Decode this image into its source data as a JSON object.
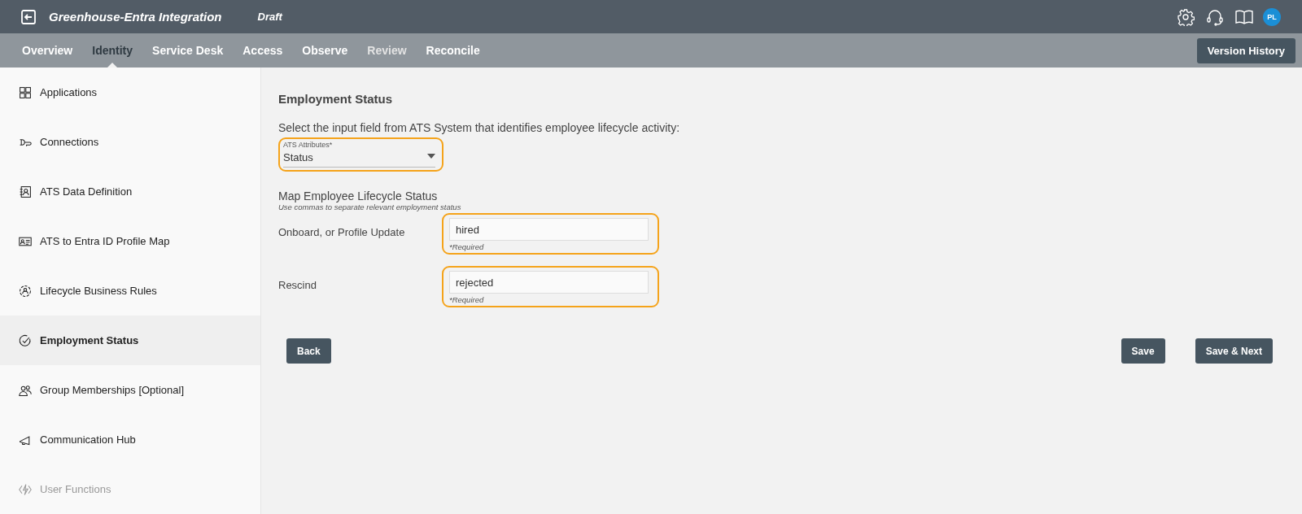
{
  "header": {
    "title": "Greenhouse-Entra Integration",
    "status": "Draft",
    "avatar": "PL"
  },
  "tabs": [
    {
      "label": "Overview",
      "selected": false,
      "disabled": false
    },
    {
      "label": "Identity",
      "selected": true,
      "disabled": false
    },
    {
      "label": "Service Desk",
      "selected": false,
      "disabled": false
    },
    {
      "label": "Access",
      "selected": false,
      "disabled": false
    },
    {
      "label": "Observe",
      "selected": false,
      "disabled": false
    },
    {
      "label": "Review",
      "selected": false,
      "disabled": true
    },
    {
      "label": "Reconcile",
      "selected": false,
      "disabled": false
    }
  ],
  "version_history_button": "Version History",
  "sidebar": {
    "items": [
      {
        "label": "Applications",
        "kind": "grid",
        "selected": false,
        "disabled": false
      },
      {
        "label": "Connections",
        "kind": "plug",
        "selected": false,
        "disabled": false
      },
      {
        "label": "ATS Data Definition",
        "kind": "contact",
        "selected": false,
        "disabled": false
      },
      {
        "label": "ATS to Entra ID Profile Map",
        "kind": "idcard",
        "selected": false,
        "disabled": false
      },
      {
        "label": "Lifecycle Business Rules",
        "kind": "cycle",
        "selected": false,
        "disabled": false
      },
      {
        "label": "Employment Status",
        "kind": "check",
        "selected": true,
        "disabled": false
      },
      {
        "label": "Group Memberships [Optional]",
        "kind": "people",
        "selected": false,
        "disabled": false
      },
      {
        "label": "Communication Hub",
        "kind": "megaphone",
        "selected": false,
        "disabled": false
      },
      {
        "label": "User Functions",
        "kind": "bolt",
        "selected": false,
        "disabled": true
      }
    ]
  },
  "content": {
    "title": "Employment Status",
    "instruction": "Select the input field from ATS System that identifies employee lifecycle activity:",
    "ats_attributes": {
      "label": "ATS Attributes*",
      "value": "Status"
    },
    "map_title": "Map Employee Lifecycle Status",
    "map_hint": "Use commas to separate relevant employment status",
    "mappings": [
      {
        "label": "Onboard, or Profile Update",
        "value": "hired",
        "helper": "*Required"
      },
      {
        "label": "Rescind",
        "value": "rejected",
        "helper": "*Required"
      }
    ],
    "buttons": {
      "back": "Back",
      "save": "Save",
      "save_next": "Save & Next"
    }
  }
}
